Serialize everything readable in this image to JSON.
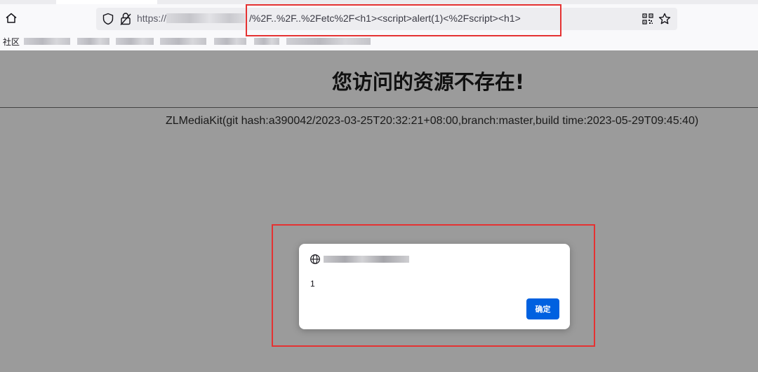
{
  "browser": {
    "url_prefix": "https://",
    "url_path": "/%2F..%2F..%2Fetc%2F<h1><script>alert(1)<%2Fscript><h1>",
    "bookmark_first_label": "社区"
  },
  "page": {
    "title": "您访问的资源不存在!",
    "server_info": "ZLMediaKit(git hash:a390042/2023-03-25T20:32:21+08:00,branch:master,build time:2023-05-29T09:45:40)"
  },
  "alert": {
    "message": "1",
    "ok_label": "确定"
  },
  "colors": {
    "page_background": "#9b9b9b",
    "highlight": "#e53232",
    "primary_button": "#0061e0"
  },
  "icons": [
    "home-icon",
    "shield-icon",
    "lock-icon",
    "qr-code-icon",
    "star-icon",
    "globe-icon"
  ]
}
